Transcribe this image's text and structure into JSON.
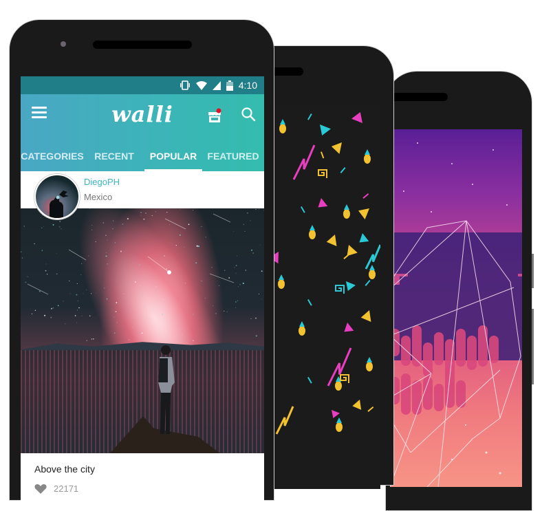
{
  "status_bar": {
    "time": "4:10",
    "icons": [
      "vibrate-icon",
      "wifi-icon",
      "signal-icon",
      "battery-icon"
    ]
  },
  "app": {
    "logo": "walli",
    "menu_icon": "hamburger-menu-icon",
    "store_icon": "store-icon",
    "search_icon": "search-icon",
    "notification_color": "#e0122a"
  },
  "tabs": [
    {
      "label": "CATEGORIES",
      "active": false
    },
    {
      "label": "RECENT",
      "active": false
    },
    {
      "label": "POPULAR",
      "active": true
    },
    {
      "label": "FEATURED",
      "active": false
    }
  ],
  "post": {
    "author": "DiegoPH",
    "location": "Mexico",
    "title": "Above the city",
    "likes": "22171"
  },
  "colors": {
    "status_bar": "#1f7e88",
    "appbar_start": "#4aa7c4",
    "appbar_end": "#34bcae",
    "author": "#3bb5c4",
    "phone_body": "#1a1a1a"
  },
  "wallpapers": [
    {
      "name": "memphis-pattern",
      "colors": [
        "#f2c230",
        "#e83fc0",
        "#2bc9d6"
      ]
    },
    {
      "name": "pixel-geometric-gradient",
      "colors": [
        "#5a1f96",
        "#c8478f",
        "#f79486"
      ]
    }
  ]
}
